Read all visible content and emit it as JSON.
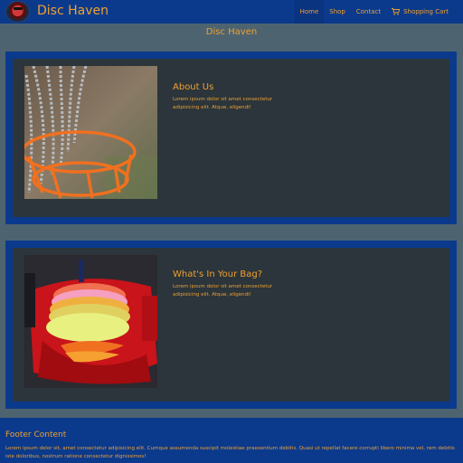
{
  "navbar": {
    "brand": "Disc Haven",
    "links": [
      {
        "label": "Home",
        "active": true
      },
      {
        "label": "Shop",
        "active": false
      },
      {
        "label": "Contact",
        "active": false
      }
    ],
    "cart_label": "Shopping Cart",
    "cart_icon": "shopping-cart-icon"
  },
  "page_title": "Disc Haven",
  "cards": [
    {
      "title": "About Us",
      "body": "Lorem ipsum dolor sit amet consectetur adipisicing elit. Atque, eligendi!",
      "image": "disc-golf-basket-chains-photo"
    },
    {
      "title": "What's In Your Bag?",
      "body": "Lorem ipsum dolor sit amet consectetur adipisicing elit. Atque, eligendi!",
      "image": "disc-golf-bag-photo"
    }
  ],
  "footer": {
    "title": "Footer Content",
    "text": "Lorem ipsum dolor sit, amet consectetur adipisicing elit. Cumque assumenda suscipit molestiae praesentium debitis. Quasi ut repellat facere corrupti libero minima vel, rem debitis iste doloribus, nostrum ratione consectetur dignissimos!"
  },
  "colors": {
    "navbar": "#0b3a8c",
    "background": "#4d6470",
    "card_inner": "#2b353b",
    "accent_text": "#f0a030"
  }
}
